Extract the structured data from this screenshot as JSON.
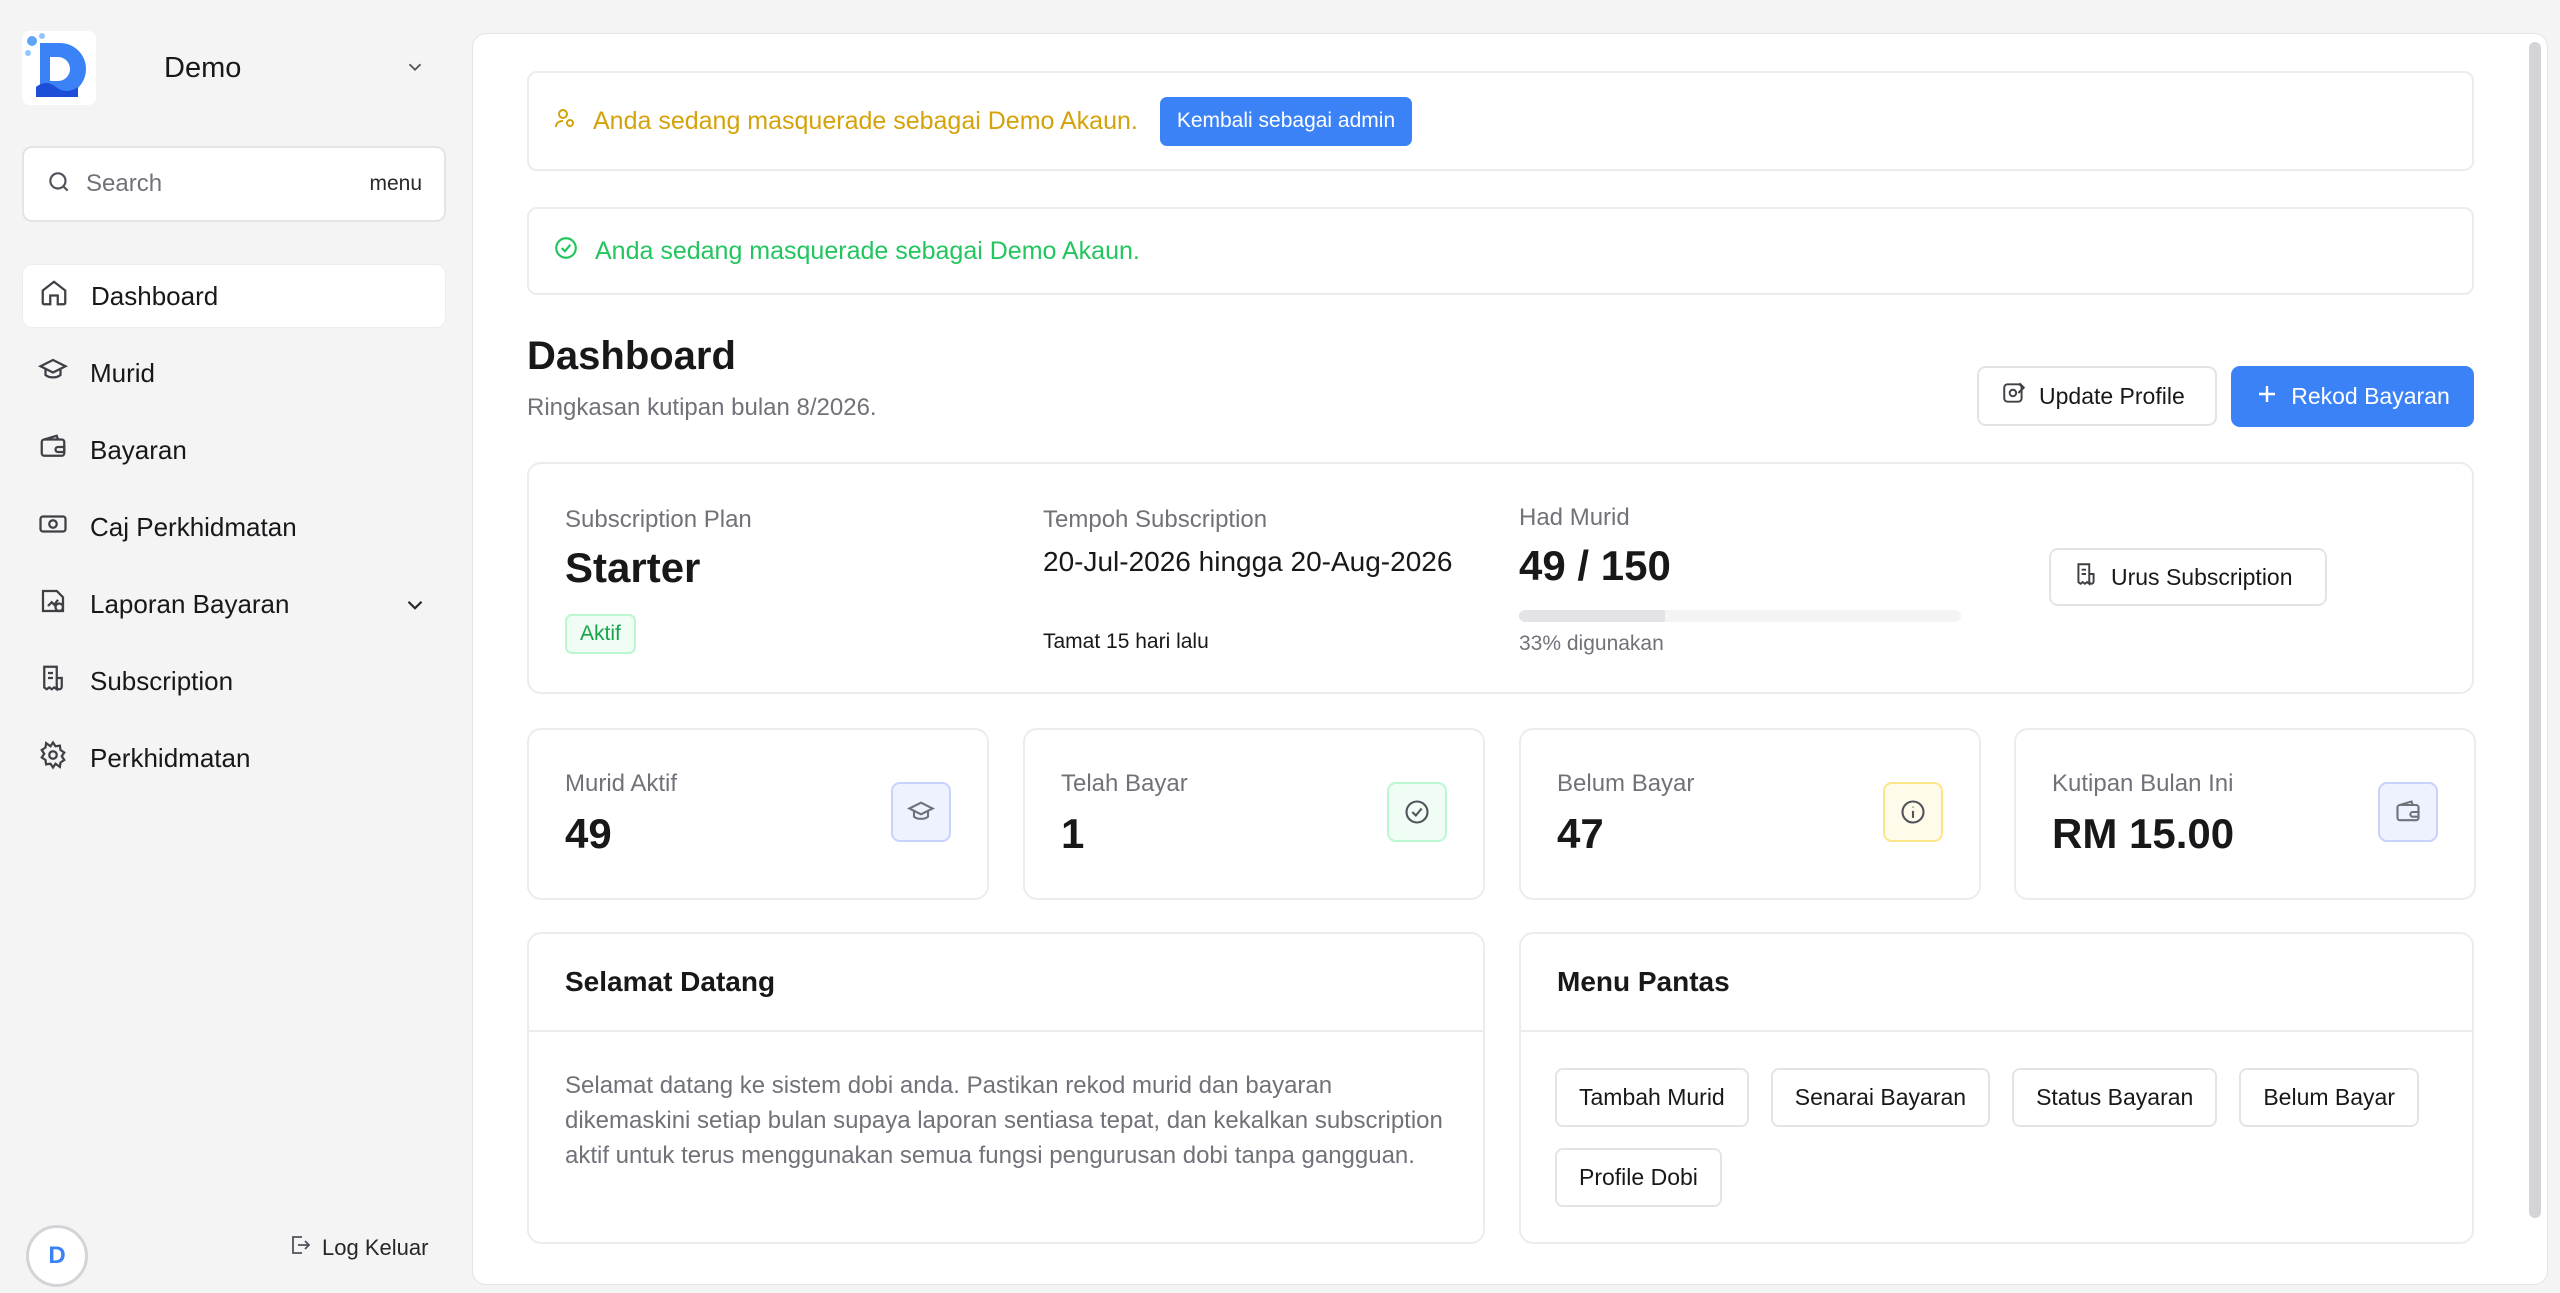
{
  "sidebar": {
    "brand": "Demo",
    "search": {
      "placeholder": "Search",
      "shortcut": "menu"
    },
    "items": [
      {
        "label": "Dashboard",
        "icon": "home-icon",
        "active": true
      },
      {
        "label": "Murid",
        "icon": "graduation-cap-icon"
      },
      {
        "label": "Bayaran",
        "icon": "wallet-icon"
      },
      {
        "label": "Caj Perkhidmatan",
        "icon": "banknote-icon"
      },
      {
        "label": "Laporan Bayaran",
        "icon": "chart-file-icon",
        "expandable": true
      },
      {
        "label": "Subscription",
        "icon": "receipt-icon"
      },
      {
        "label": "Perkhidmatan",
        "icon": "gear-icon"
      }
    ],
    "user_initial": "D",
    "logout": "Log Keluar"
  },
  "alerts": {
    "masquerade": "Anda sedang masquerade sebagai Demo Akaun.",
    "back_admin": "Kembali sebagai admin",
    "success": "Anda sedang masquerade sebagai Demo Akaun."
  },
  "header": {
    "title": "Dashboard",
    "subtitle": "Ringkasan kutipan bulan 8/2026.",
    "update_profile": "Update Profile",
    "record_payment": "Rekod Bayaran"
  },
  "subscription": {
    "plan_label": "Subscription Plan",
    "plan": "Starter",
    "status": "Aktif",
    "period_label": "Tempoh Subscription",
    "period": "20-Jul-2026 hingga 20-Aug-2026",
    "expired": "Tamat 15 hari lalu",
    "limit_label": "Had Murid",
    "limit": "49 / 150",
    "usage_fraction": 0.33,
    "usage_text": "33% digunakan",
    "manage": "Urus Subscription"
  },
  "stats": [
    {
      "label": "Murid Aktif",
      "value": "49",
      "icon": "graduation-cap-icon",
      "color": "#6b7fd7"
    },
    {
      "label": "Telah Bayar",
      "value": "1",
      "icon": "check-circle-icon",
      "color": "#22c55e"
    },
    {
      "label": "Belum Bayar",
      "value": "47",
      "icon": "info-icon",
      "color": "#eab308"
    },
    {
      "label": "Kutipan Bulan Ini",
      "value": "RM 15.00",
      "icon": "wallet-icon",
      "color": "#6b7fd7"
    }
  ],
  "welcome": {
    "title": "Selamat Datang",
    "text": "Selamat datang ke sistem dobi anda. Pastikan rekod murid dan bayaran dikemaskini setiap bulan supaya laporan sentiasa tepat, dan kekalkan subscription aktif untuk terus menggunakan semua fungsi pengurusan dobi tanpa gangguan."
  },
  "quick_menu": {
    "title": "Menu Pantas",
    "buttons": [
      "Tambah Murid",
      "Senarai Bayaran",
      "Status Bayaran",
      "Belum Bayar",
      "Profile Dobi"
    ]
  },
  "colors": {
    "accent": "#3b82f6",
    "warning": "#d4a20a",
    "success": "#22c55e"
  }
}
